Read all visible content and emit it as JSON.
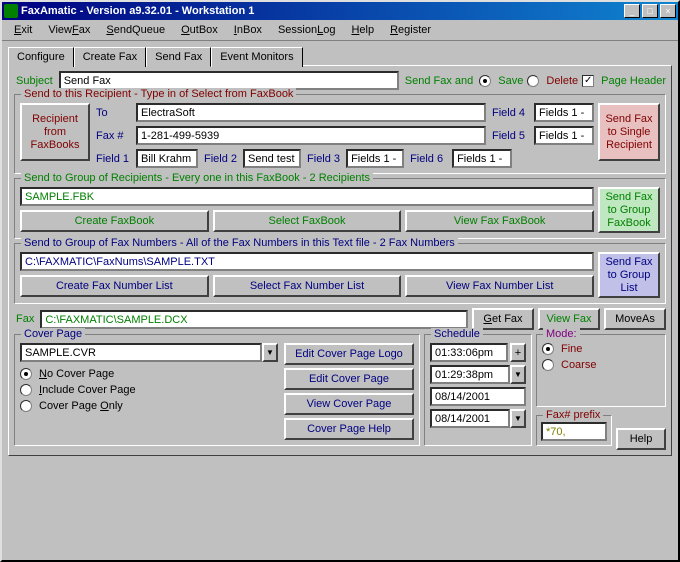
{
  "title": "FaxAmatic - Version a9.32.01 - Workstation 1",
  "menu": [
    "Exit",
    "ViewFax",
    "SendQueue",
    "OutBox",
    "InBox",
    "SessionLog",
    "Help",
    "Register"
  ],
  "menuAccel": [
    "E",
    "F",
    "S",
    "O",
    "I",
    "L",
    "H",
    "R"
  ],
  "tabs": [
    "Configure",
    "Create Fax",
    "Send Fax",
    "Event Monitors"
  ],
  "subject": {
    "label": "Subject",
    "value": "Send Fax"
  },
  "sendFaxAnd": "Send Fax and",
  "saveLabel": "Save",
  "deleteLabel": "Delete",
  "pageHeader": "Page Header",
  "recip": {
    "legend": "Send to this Recipient - Type in of Select from FaxBook",
    "fromBtn": "Recipient\nfrom\nFaxBooks",
    "toLbl": "To",
    "toVal": "ElectraSoft",
    "faxLbl": "Fax #",
    "faxVal": "1-281-499-5939",
    "f1Lbl": "Field 1",
    "f1Val": "Bill Krahm",
    "f2Lbl": "Field 2",
    "f2Val": "Send test",
    "f3Lbl": "Field 3",
    "f3Val": "Fields 1 -",
    "f4Lbl": "Field 4",
    "f4Val": "Fields 1 -",
    "f5Lbl": "Field 5",
    "f5Val": "Fields 1 -",
    "f6Lbl": "Field 6",
    "f6Val": "Fields 1 -",
    "sendBtn": "Send Fax\nto Single\nRecipient"
  },
  "group": {
    "legend": "Send to Group of Recipients - Every one in this FaxBook - 2 Recipients",
    "file": "SAMPLE.FBK",
    "create": "Create FaxBook",
    "select": "Select FaxBook",
    "view": "View Fax FaxBook",
    "sendBtn": "Send Fax\nto Group\nFaxBook"
  },
  "nums": {
    "legend": "Send to Group of Fax Numbers - All of the Fax Numbers in this Text file - 2 Fax Numbers",
    "file": "C:\\FAXMATIC\\FaxNums\\SAMPLE.TXT",
    "create": "Create Fax Number List",
    "select": "Select Fax Number List",
    "view": "View Fax Number List",
    "sendBtn": "Send Fax\nto Group\nList"
  },
  "fax": {
    "label": "Fax",
    "value": "C:\\FAXMATIC\\SAMPLE.DCX",
    "get": "Get Fax",
    "view": "View Fax",
    "move": "MoveAs"
  },
  "cover": {
    "legend": "Cover Page",
    "file": "SAMPLE.CVR",
    "noCover": "No Cover Page",
    "include": "Include Cover Page",
    "only": "Cover Page Only",
    "editLogo": "Edit Cover Page Logo",
    "edit": "Edit Cover Page",
    "viewBtn": "View Cover Page",
    "help": "Cover Page Help"
  },
  "sched": {
    "legend": "Schedule",
    "time1": "01:33:06pm",
    "time2": "01:29:38pm",
    "date1": "08/14/2001",
    "date2": "08/14/2001",
    "plus": "+"
  },
  "mode": {
    "legend": "Mode:",
    "fine": "Fine",
    "coarse": "Coarse"
  },
  "prefix": {
    "legend": "Fax# prefix",
    "value": "*70,"
  },
  "help": "Help"
}
